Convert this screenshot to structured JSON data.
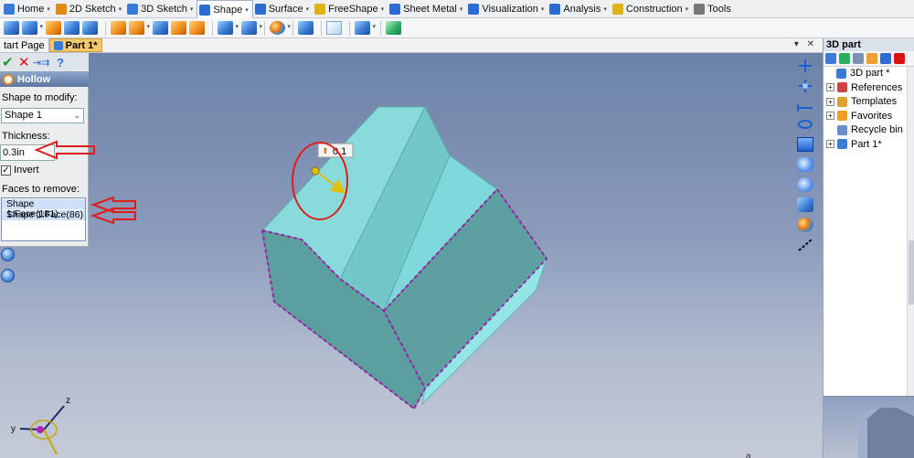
{
  "ribbon": {
    "tabs": [
      {
        "label": "Home",
        "icon": "home-icon",
        "color": "#3a7bd5"
      },
      {
        "label": "2D Sketch",
        "icon": "sketch-2d-icon",
        "color": "#e08a1a"
      },
      {
        "label": "3D Sketch",
        "icon": "sketch-3d-icon",
        "color": "#3a7bd5"
      },
      {
        "label": "Shape",
        "icon": "shape-icon",
        "color": "#2b6dd1"
      },
      {
        "label": "Surface",
        "icon": "surface-icon",
        "color": "#2b6dd1"
      },
      {
        "label": "FreeShape",
        "icon": "freeshape-icon",
        "color": "#e0b21a"
      },
      {
        "label": "Sheet Metal",
        "icon": "sheet-metal-icon",
        "color": "#2b6dd1"
      },
      {
        "label": "Visualization",
        "icon": "visualization-icon",
        "color": "#2b6dd1"
      },
      {
        "label": "Analysis",
        "icon": "analysis-icon",
        "color": "#2b6dd1"
      },
      {
        "label": "Construction",
        "icon": "construction-icon",
        "color": "#e0b21a"
      },
      {
        "label": "Tools",
        "icon": "tools-icon",
        "color": "#777777"
      }
    ],
    "active_tab": "Shape"
  },
  "doc_tabs": {
    "start_page": "tart Page",
    "part": "Part 1*",
    "controls": "▾ ✕"
  },
  "hollow_panel": {
    "title": "Hollow",
    "shape_label": "Shape to modify:",
    "shape_value": "Shape 1",
    "thickness_label": "Thickness:",
    "thickness_value": "0.3in",
    "invert_label": "Invert",
    "invert_checked": true,
    "faces_label": "Faces to remove:",
    "faces": [
      "Shape 1:Face(181)",
      "Shape 1:Face(86)"
    ]
  },
  "viewport": {
    "dimension_tag": "0.1",
    "axis_labels": {
      "x": "x",
      "y": "y",
      "z": "z"
    },
    "corner_text": "a"
  },
  "right_panel": {
    "title": "3D part",
    "tree": [
      {
        "label": "3D part *",
        "level": 0,
        "expand": "",
        "icon": "part-root-icon"
      },
      {
        "label": "References",
        "level": 1,
        "expand": "+",
        "icon": "references-icon"
      },
      {
        "label": "Templates",
        "level": 1,
        "expand": "+",
        "icon": "templates-icon"
      },
      {
        "label": "Favorites",
        "level": 1,
        "expand": "+",
        "icon": "favorites-icon"
      },
      {
        "label": "Recycle bin",
        "level": 1,
        "expand": "",
        "icon": "recycle-bin-icon"
      },
      {
        "label": "Part 1*",
        "level": 1,
        "expand": "+",
        "icon": "part-icon"
      }
    ]
  },
  "colors": {
    "solid_face_light": "#7fd6d8",
    "solid_face_dark": "#5c9fa0",
    "selection_edge": "#9b1fa8",
    "annotation_red": "#e11a1a",
    "active_tab": "#2b6dd1"
  }
}
